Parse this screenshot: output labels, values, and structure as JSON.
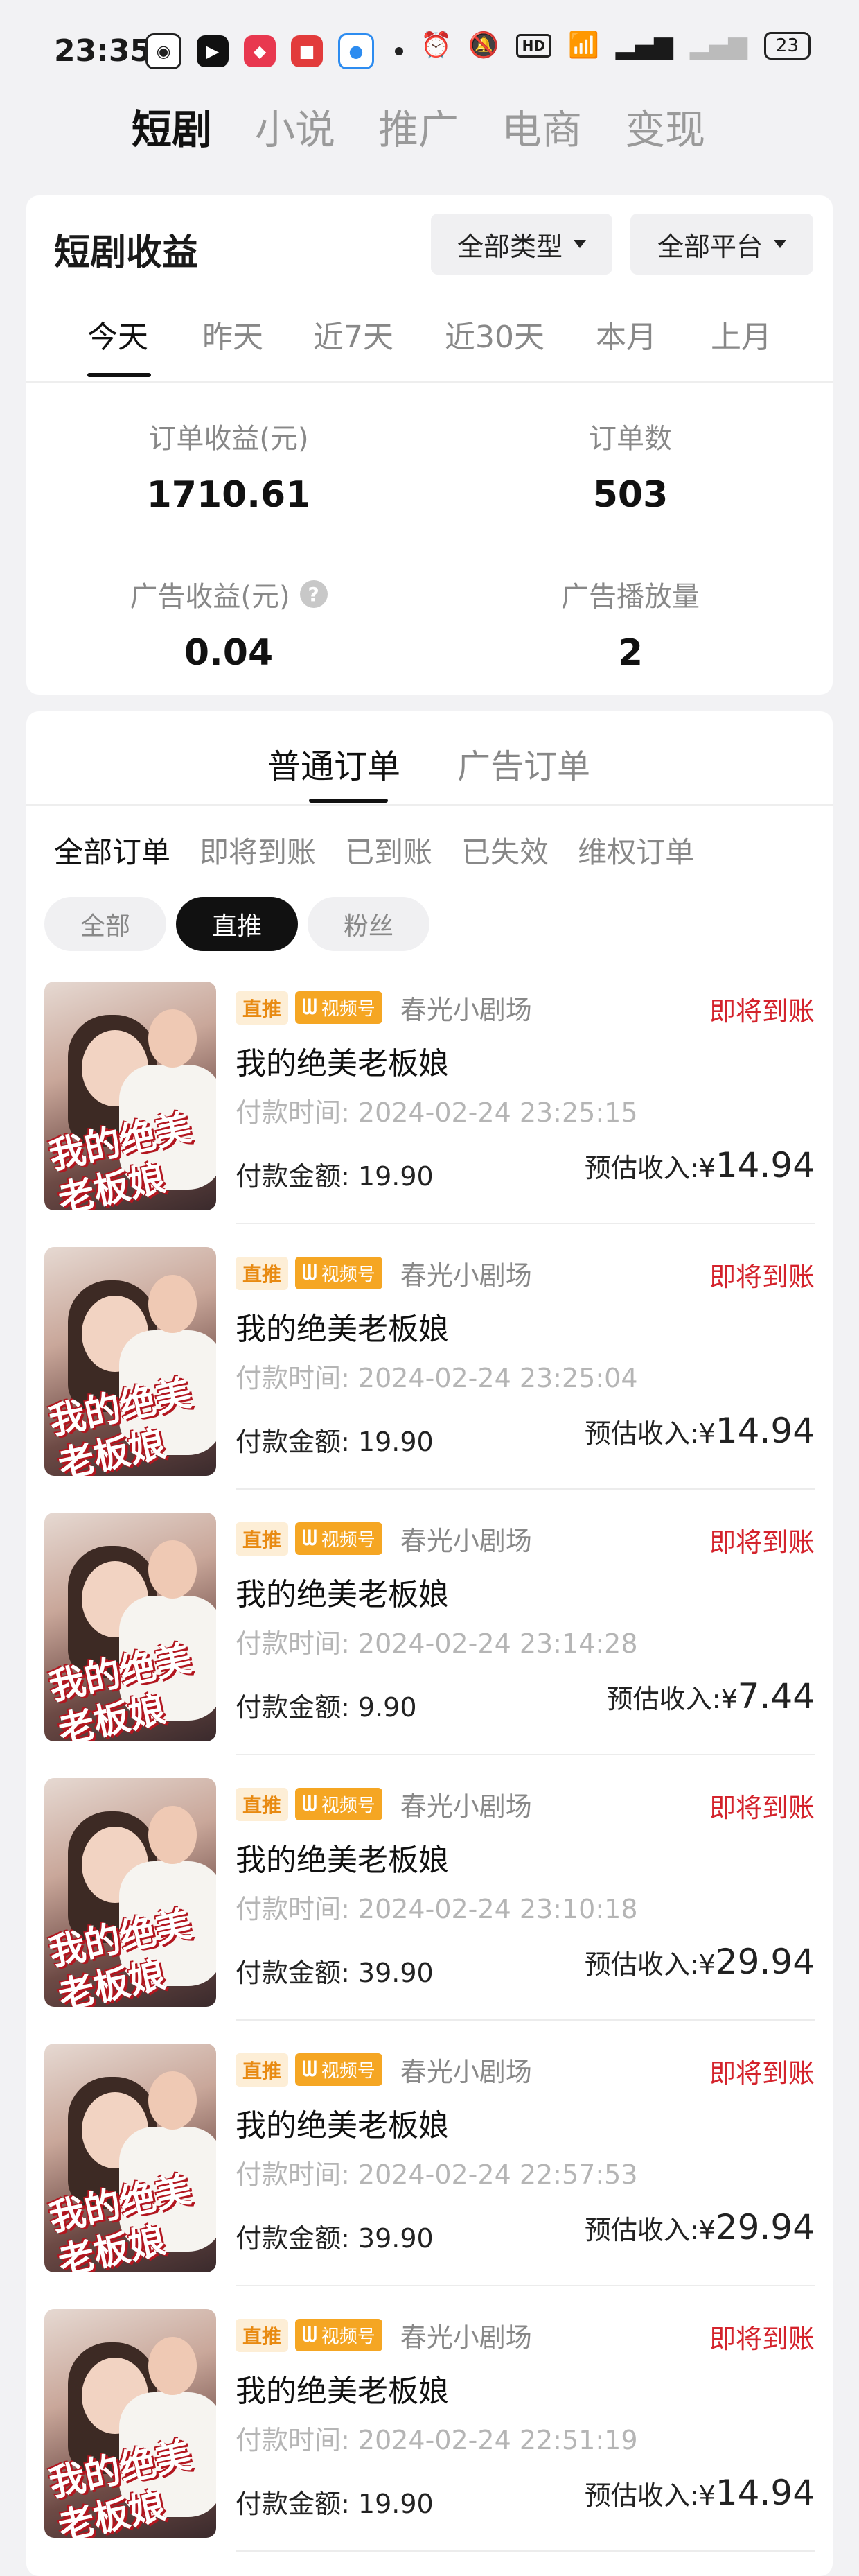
{
  "status_bar": {
    "time": "23:35",
    "battery": "23"
  },
  "top_nav": {
    "tabs": [
      "短剧",
      "小说",
      "推广",
      "电商",
      "变现"
    ],
    "active": 0
  },
  "income": {
    "title": "短剧收益",
    "type_dropdown": "全部类型",
    "platform_dropdown": "全部平台",
    "periods": [
      "今天",
      "昨天",
      "近7天",
      "近30天",
      "本月",
      "上月"
    ],
    "metrics": {
      "order_income_label": "订单收益(元)",
      "order_income_value": "1710.61",
      "order_count_label": "订单数",
      "order_count_value": "503",
      "ad_income_label": "广告收益(元)",
      "ad_income_value": "0.04",
      "ad_plays_label": "广告播放量",
      "ad_plays_value": "2"
    }
  },
  "orders": {
    "tabs": [
      "普通订单",
      "广告订单"
    ],
    "filters": [
      "全部订单",
      "即将到账",
      "已到账",
      "已失效",
      "维权订单"
    ],
    "pills": [
      "全部",
      "直推",
      "粉丝"
    ],
    "tag_direct": "直推",
    "tag_channel": "视频号",
    "thumb_text": "我的绝美老板娘",
    "time_label": "付款时间:",
    "amount_label": "付款金额:",
    "estimate_label": "预估收入:",
    "currency": "¥",
    "items": [
      {
        "source": "春光小剧场",
        "status": "即将到账",
        "title": "我的绝美老板娘",
        "time": "2024-02-24 23:25:15",
        "amount": "19.90",
        "estimate": "14.94"
      },
      {
        "source": "春光小剧场",
        "status": "即将到账",
        "title": "我的绝美老板娘",
        "time": "2024-02-24 23:25:04",
        "amount": "19.90",
        "estimate": "14.94"
      },
      {
        "source": "春光小剧场",
        "status": "即将到账",
        "title": "我的绝美老板娘",
        "time": "2024-02-24 23:14:28",
        "amount": "9.90",
        "estimate": "7.44"
      },
      {
        "source": "春光小剧场",
        "status": "即将到账",
        "title": "我的绝美老板娘",
        "time": "2024-02-24 23:10:18",
        "amount": "39.90",
        "estimate": "29.94"
      },
      {
        "source": "春光小剧场",
        "status": "即将到账",
        "title": "我的绝美老板娘",
        "time": "2024-02-24 22:57:53",
        "amount": "39.90",
        "estimate": "29.94"
      },
      {
        "source": "春光小剧场",
        "status": "即将到账",
        "title": "我的绝美老板娘",
        "time": "2024-02-24 22:51:19",
        "amount": "19.90",
        "estimate": "14.94"
      }
    ]
  }
}
